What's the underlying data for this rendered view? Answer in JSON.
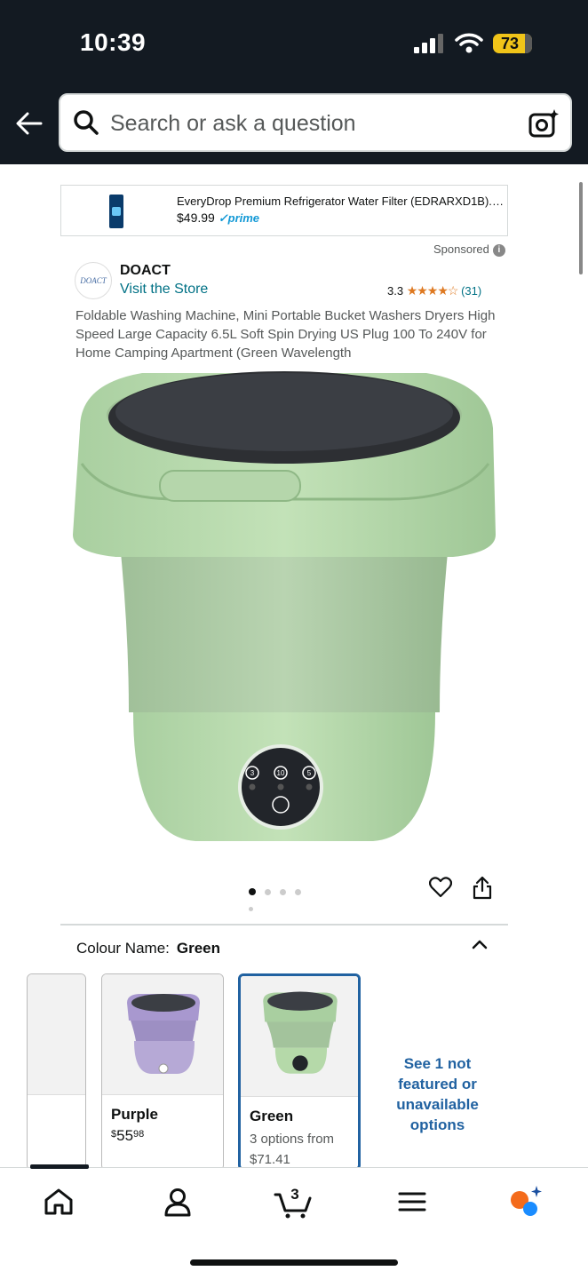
{
  "status_bar": {
    "time": "10:39",
    "battery": "73"
  },
  "search": {
    "placeholder": "Search or ask a question"
  },
  "sponsored_ad": {
    "title": "EveryDrop Premium Refrigerator Water Filter (EDRARXD1B). T...",
    "price": "$49.99",
    "prime": "prime",
    "sponsored_label": "Sponsored"
  },
  "brand": {
    "logo_text": "DOACT",
    "name": "DOACT",
    "visit_link": "Visit the Store"
  },
  "rating": {
    "value": "3.3",
    "stars": "★★★★☆",
    "count": "(31)"
  },
  "product": {
    "title": "Foldable Washing Machine, Mini Portable Bucket Washers Dryers High Speed Large Capacity 6.5L Soft Spin Drying US Plug 100 To 240V for Home Camping Apartment (Green Wavelength",
    "panel_labels": [
      "3",
      "10",
      "5"
    ],
    "image_count": 5,
    "active_image": 1
  },
  "colour": {
    "label": "Colour Name:",
    "selected": "Green",
    "options": [
      {
        "name": "Purple",
        "price_whole": "55",
        "price_fraction": "98",
        "currency": "$"
      },
      {
        "name": "Green",
        "options_text": "3 options from",
        "price": "$71.41"
      }
    ],
    "see_more": "See 1 not featured or unavailable options"
  },
  "bottom_nav": {
    "cart_count": "3",
    "items": [
      "home-icon",
      "account-icon",
      "cart-icon",
      "menu-icon",
      "rufus-icon"
    ]
  },
  "colors": {
    "header_bg": "#131a22",
    "link": "#007185",
    "star": "#de7921",
    "selected_border": "#2162a1",
    "product_green": "#b5d9a9"
  }
}
